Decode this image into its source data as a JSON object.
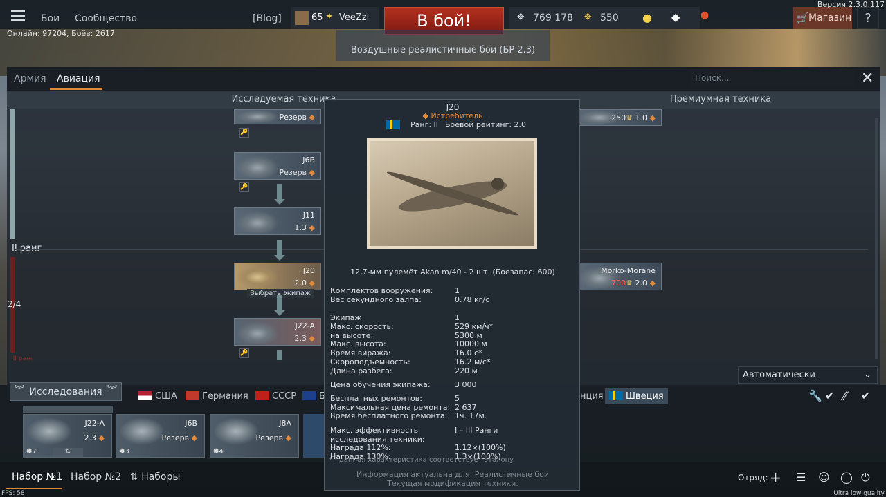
{
  "top": {
    "nav": [
      "Бои",
      "Сообщество"
    ],
    "blog": "[Blog]",
    "player_level": "65",
    "player_name": "VeeZzi",
    "battle_button": "В бой!",
    "silver": "769 178",
    "gold": "550",
    "shop": "Магазин",
    "help": "?",
    "version": "Версия 2.3.0.117",
    "online": "Онлайн: 97204, Боёв: 2617",
    "mode": "Воздушные реалистичные бои (БР 2.3)"
  },
  "panel": {
    "tabs": [
      "Армия",
      "Авиация"
    ],
    "active_tab": "Авиация",
    "search_placeholder": "Поиск...",
    "col_research": "Исследуемая техника",
    "col_premium": "Премиумная техника",
    "rank_label": "II ранг",
    "rank_progress": "2/4",
    "rank_next": "III ранг"
  },
  "tree": [
    {
      "name": "",
      "sub": "Резерв"
    },
    {
      "name": "J6B",
      "sub": "Резерв"
    },
    {
      "name": "J11",
      "sub": "1.3"
    },
    {
      "name": "J20",
      "sub": "2.0"
    },
    {
      "name": "J22-A",
      "sub": "2.3"
    }
  ],
  "crew_tooltip": "Выбрать экипаж",
  "premium": [
    {
      "name": "",
      "price": "250",
      "br": "1.0"
    },
    {
      "name": "Morko-Morane",
      "price": "700",
      "br": "2.0"
    }
  ],
  "tooltip": {
    "name": "J20",
    "class": "Истребитель",
    "rank": "Ранг: II",
    "br": "Боевой рейтинг: 2.0",
    "weapon": "12,7-мм пулемёт Akan m/40 - 2 шт. (Боезапас: 600)",
    "stats": [
      [
        "Комплектов вооружения:",
        "1"
      ],
      [
        "Вес секундного залпа:",
        "0.78 кг/с"
      ],
      [
        "Экипаж",
        "1"
      ],
      [
        "Макс. скорость:",
        "529 км/ч*"
      ],
      [
        "на высоте:",
        "5300 м"
      ],
      [
        "Макс. высота:",
        "10000 м"
      ],
      [
        "Время виража:",
        "16.0 с*"
      ],
      [
        "Скороподъёмность:",
        "16.2 м/с*"
      ],
      [
        "Длина разбега:",
        "220 м"
      ],
      [
        "Цена обучения экипажа:",
        "3 000"
      ],
      [
        "Бесплатных ремонтов:",
        "5"
      ],
      [
        "Максимальная цена ремонта:",
        "2 637"
      ],
      [
        "Время бесплатного ремонта:",
        "1ч. 17м."
      ],
      [
        "Макс. эффективность",
        "I – III Ранги"
      ],
      [
        "исследования техники:",
        ""
      ],
      [
        "Награда 112%:",
        "1.12×(100%)"
      ],
      [
        "Награда 130%:",
        "1.3×(100%)"
      ]
    ],
    "note": "* - данная характеристика соответствует эталону",
    "info1": "Информация актуальна для: Реалистичные бои",
    "info2": "Текущая модификация техники."
  },
  "auto": "Автоматически",
  "research_button": "Исследования",
  "countries": [
    "США",
    "Германия",
    "СССР",
    "Б",
    "нция",
    "Швеция"
  ],
  "slots": [
    {
      "name": "J22-A",
      "sub": "2.3",
      "crew": "7"
    },
    {
      "name": "J6B",
      "sub": "Резерв",
      "crew": "3"
    },
    {
      "name": "J8A",
      "sub": "Резерв",
      "crew": "4"
    }
  ],
  "presets": [
    "Набор №1",
    "Набор №2",
    "Наборы"
  ],
  "squad": "Отряд:",
  "fps": "FPS: 58",
  "quality": "Ultra low quality",
  "colors": {
    "accent": "#e08a3c",
    "battle": "#b4301e",
    "green": "#8fdc4e"
  }
}
